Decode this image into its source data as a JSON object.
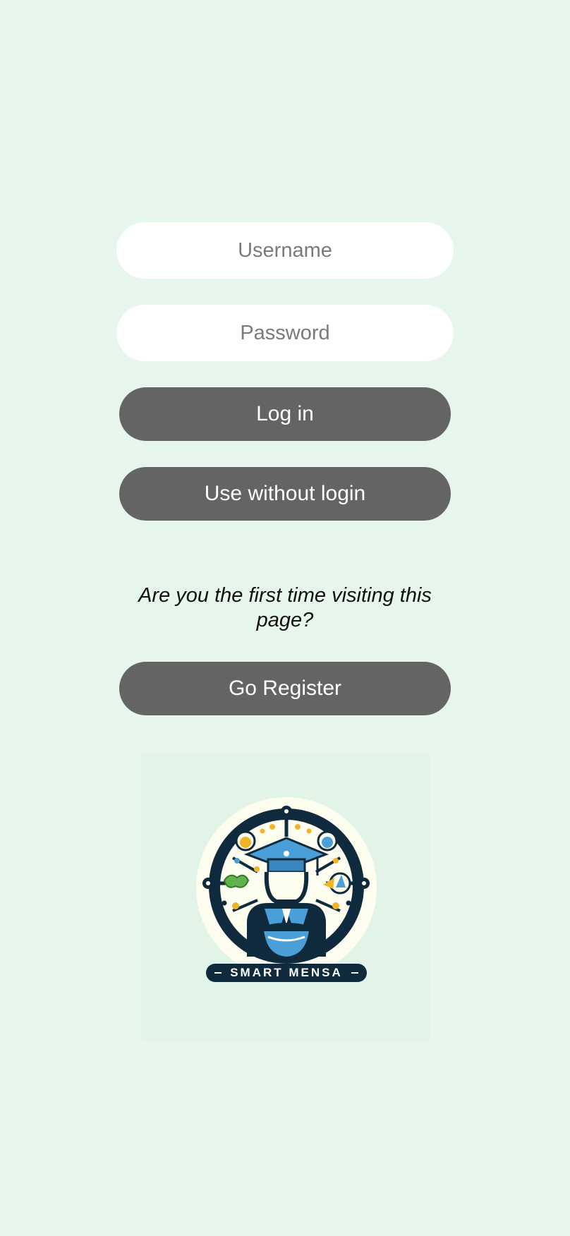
{
  "login": {
    "username": {
      "value": "",
      "placeholder": "Username"
    },
    "password": {
      "value": "",
      "placeholder": "Password"
    },
    "login_label": "Log in",
    "guest_label": "Use without login"
  },
  "register": {
    "prompt": "Are you the first time visiting this page?",
    "button_label": "Go Register"
  },
  "logo": {
    "text": "SMART MENSA",
    "icon": "smart-mensa-logo-icon"
  },
  "colors": {
    "background": "#e6f6ec",
    "button": "#656464",
    "button_text": "#ffffff",
    "field": "#ffffff",
    "logo_navy": "#0f2a3d",
    "logo_blue": "#4a9fd8"
  }
}
